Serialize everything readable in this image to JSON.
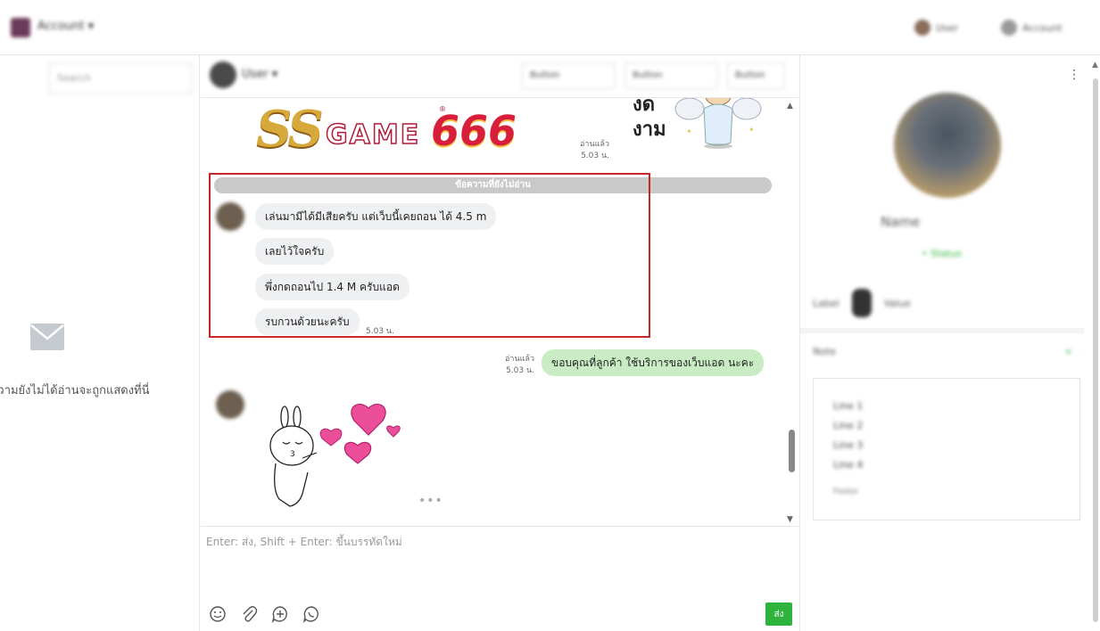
{
  "topbar": {
    "account_name": "Account ▾",
    "right_item_1": "User",
    "right_item_2": "Account"
  },
  "left": {
    "search_placeholder": "Search",
    "empty_text": "ข้อความยังไม่ได้อ่านจะถูกแสดงที่นี่",
    "empty_icon": "envelope-icon"
  },
  "chat_header": {
    "name": "User ▾",
    "btn_1": "Button",
    "btn_2": "Button",
    "btn_3": "Button"
  },
  "chat": {
    "logo": {
      "ss": "SS",
      "game": "GAME",
      "n666": "666",
      "tm": "®"
    },
    "logo_read": "อ่านแล้ว",
    "logo_time": "5.03 น.",
    "sticker_text_1": "งด",
    "sticker_text_2": "งาม",
    "unread_divider": "ข้อความที่ยังไม่อ่าน",
    "incoming": [
      {
        "text": "เล่นมามีได้มีเสียครับ แต่เว็บนี้เคยถอน ได้ 4.5 m"
      },
      {
        "text": "เลยไว้ใจครับ"
      },
      {
        "text": "พึ่งกดถอนไป 1.4 M ครับแอด"
      },
      {
        "text": "รบกวนด้วยนะครับ"
      }
    ],
    "incoming_time": "5.03 น.",
    "outgoing": {
      "text": "ขอบคุณที่ลูกค้า ใช้บริการของเว็บแอด นะคะ",
      "read": "อ่านแล้ว",
      "time": "5.03 น."
    },
    "more": "•••"
  },
  "input": {
    "placeholder": "Enter: ส่ง, Shift + Enter: ขึ้นบรรทัดใหม่",
    "value": "",
    "send_label": "ส่ง",
    "icons": [
      "smile-icon",
      "paperclip-icon",
      "add-chat-icon",
      "line-icon"
    ]
  },
  "profile": {
    "name": "Name",
    "status": "• Status",
    "row_label": "Label",
    "row_value": "Value",
    "note_title": "Note",
    "note_add": "+",
    "note_lines": [
      "Line 1",
      "Line 2",
      "Line 3",
      "Line 4"
    ],
    "note_footer": "Footer"
  },
  "colors": {
    "accent_green": "#2eb43c",
    "highlight_red": "#c62828",
    "incoming_bubble": "#eef0f2",
    "outgoing_bubble": "#c9ecc4"
  }
}
